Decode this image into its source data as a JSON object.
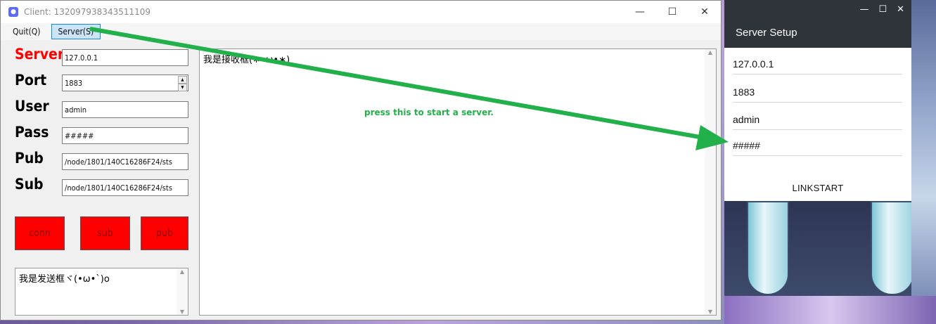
{
  "client_window": {
    "title": "Client: 132097938343511109",
    "controls": {
      "minimize": "—",
      "maximize": "☐",
      "close": "✕"
    },
    "menu": [
      {
        "label": "Quit(Q)"
      },
      {
        "label": "Server(S)"
      }
    ],
    "labels": {
      "server": "Server",
      "port": "Port",
      "user": "User",
      "pass": "Pass",
      "pub": "Pub",
      "sub": "Sub"
    },
    "fields": {
      "server": "127.0.0.1",
      "port": "1883",
      "user": "admin",
      "pass": "#####",
      "pub": "/node/1801/140C16286F24/sts",
      "sub": "/node/1801/140C16286F24/sts"
    },
    "buttons": {
      "conn": "conn",
      "sub": "sub",
      "pub": "pub"
    },
    "send_box_text": "我是发送框ヾ(•ω•`)o",
    "receive_box_text": "我是接收框(∗•ω•∗)"
  },
  "annotation": {
    "text": "press this to start a server.",
    "color": "#22b04b"
  },
  "server_setup": {
    "title": "Server Setup",
    "controls": {
      "minimize": "—",
      "maximize": "☐",
      "close": "✕"
    },
    "fields": {
      "host": "127.0.0.1",
      "port": "1883",
      "user": "admin",
      "pass": "#####"
    },
    "button": "LINKSTART"
  },
  "colors": {
    "accent_red": "#ff0000",
    "menu_selected": "#cce4f7",
    "setup_header": "#2e3439",
    "arrow": "#22b04b"
  }
}
